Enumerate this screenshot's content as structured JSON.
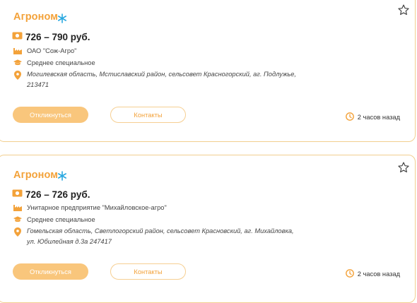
{
  "vacancies": [
    {
      "title": "Агроном",
      "salary": "726 – 790 руб.",
      "company": "ОАО \"Сож-Агро\"",
      "education": "Среднее специальное",
      "address": "Могилевская область, Мстиславский район, сельсовет Красногорский, аг. Подлужье, 213471",
      "apply_label": "Откликнуться",
      "contacts_label": "Контакты",
      "posted": "2 часов назад"
    },
    {
      "title": "Агроном",
      "salary": "726 – 726 руб.",
      "company": "Унитарное предприятие \"Михайловское-агро\"",
      "education": "Среднее специальное",
      "address": "Гомельская область, Светлогорский район, сельсовет Красновский, аг. Михайловка, ул. Юбилейная д.3а 247417",
      "apply_label": "Откликнуться",
      "contacts_label": "Контакты",
      "posted": "2 часов назад"
    }
  ],
  "icons": {
    "badge": "snowflake-icon",
    "favorite": "star-outline-icon",
    "salary": "money-icon",
    "company": "factory-icon",
    "education": "graduation-cap-icon",
    "address": "location-pin-icon",
    "time": "clock-icon"
  },
  "colors": {
    "accent": "#f3a23a",
    "button_fill": "#f9c67c",
    "card_border": "#f2cf8f",
    "badge": "#29a8e0"
  }
}
